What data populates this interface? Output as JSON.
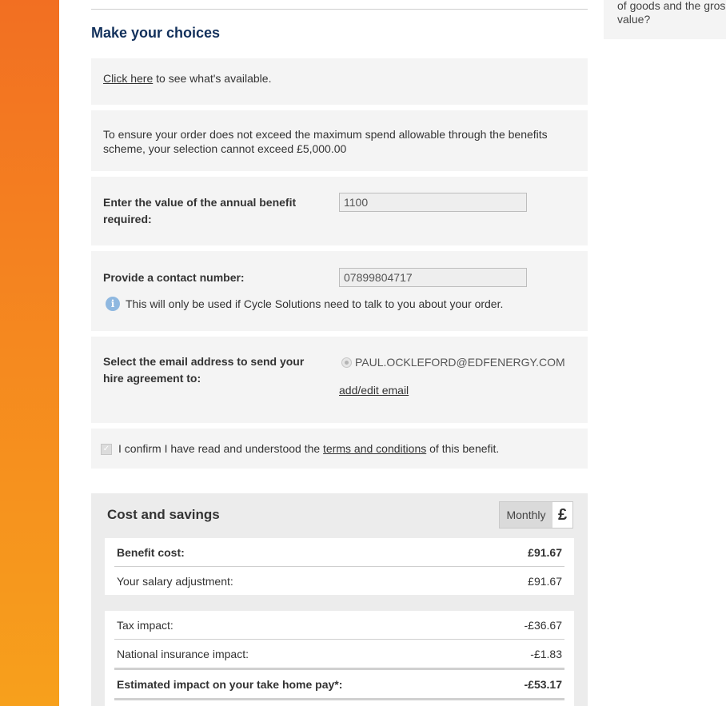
{
  "sidebar_snippet": {
    "text": "of goods and the gros value?"
  },
  "section": {
    "title": "Make your choices"
  },
  "availability": {
    "link_text": "Click here",
    "rest_text": " to see what's available."
  },
  "notice": {
    "text": "To ensure your order does not exceed the maximum spend allowable through the benefits scheme, your selection cannot exceed £5,000.00"
  },
  "annual_benefit": {
    "label": "Enter the value of the annual benefit required:",
    "value": "1100"
  },
  "contact": {
    "label": "Provide a contact number:",
    "value": "07899804717",
    "info": "This will only be used if Cycle Solutions need to talk to you about your order."
  },
  "email": {
    "label": "Select the email address to send your hire agreement to:",
    "option": "PAUL.OCKLEFORD@EDFENERGY.COM",
    "edit_link": "add/edit email"
  },
  "confirm": {
    "prefix": "I confirm I have read and understood the ",
    "link": "terms and conditions",
    "suffix": " of this benefit.",
    "checked": true
  },
  "cost": {
    "title": "Cost and savings",
    "toggle_label": "Monthly",
    "currency_symbol": "£",
    "benefit_cost": {
      "label": "Benefit cost:",
      "value": "£91.67"
    },
    "salary_adjustment": {
      "label": "Your salary adjustment:",
      "value": "£91.67"
    },
    "tax_impact": {
      "label": "Tax impact:",
      "value": "-£36.67"
    },
    "ni_impact": {
      "label": "National insurance impact:",
      "value": "-£1.83"
    },
    "take_home": {
      "label": "Estimated impact on your take home pay*:",
      "value": "-£53.17"
    }
  },
  "colors": {
    "accent_orange": "#f26f22",
    "title_navy": "#13315c",
    "panel_grey": "#f4f4f4"
  }
}
